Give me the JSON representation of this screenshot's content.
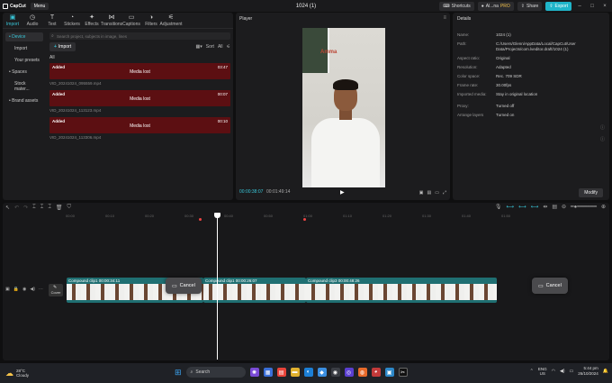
{
  "titlebar": {
    "app_name": "CapCut",
    "menu_label": "Menu",
    "document_title": "1024 (1)",
    "shortcuts_label": "Shortcuts",
    "user_label": "Al...na",
    "pro_badge": "PRO",
    "share_label": "Share",
    "export_label": "Export"
  },
  "tools": [
    {
      "label": "Import",
      "icon": "import-icon"
    },
    {
      "label": "Audio",
      "icon": "audio-icon"
    },
    {
      "label": "Text",
      "icon": "text-icon"
    },
    {
      "label": "Stickers",
      "icon": "stickers-icon"
    },
    {
      "label": "Effects",
      "icon": "effects-icon"
    },
    {
      "label": "Transitions",
      "icon": "transitions-icon"
    },
    {
      "label": "Captions",
      "icon": "captions-icon"
    },
    {
      "label": "Filters",
      "icon": "filters-icon"
    },
    {
      "label": "Adjustment",
      "icon": "adjustment-icon"
    }
  ],
  "media_sidebar": {
    "device": "• Device",
    "import": "Import",
    "your_presets": "Your presets",
    "spaces": "• Spaces",
    "stock": "Stock mater...",
    "brand": "• Brand assets"
  },
  "media": {
    "search_placeholder": "Search project, subjects in image, lines",
    "import_label": "Import",
    "sort_label": "Sort",
    "all_filter": "All",
    "all_label": "All",
    "clips": [
      {
        "added": "Added",
        "duration": "03:47",
        "status": "Media lost",
        "name": "VID_20241024_095559.mp4"
      },
      {
        "added": "Added",
        "duration": "00:07",
        "status": "Media lost",
        "name": "VID_20241024_113123.mp4"
      },
      {
        "added": "Added",
        "duration": "00:10",
        "status": "Media lost",
        "name": "VID_20241024_113306.mp4"
      }
    ]
  },
  "player": {
    "title": "Player",
    "video_sign": "Amma",
    "time_current": "00:00:38:07",
    "time_total": "00:01:49:14"
  },
  "details": {
    "title": "Details",
    "rows": [
      {
        "key": "Name:",
        "value": "1024 (1)"
      },
      {
        "key": "Path:",
        "value": "C:/Users/Glenn/AppData/Local/CapCut/User Data/Projects/com.lveditor.draft/1024 (1)"
      },
      {
        "key": "Aspect ratio:",
        "value": "Original"
      },
      {
        "key": "Resolution:",
        "value": "Adapted"
      },
      {
        "key": "Color space:",
        "value": "Rec. 709 SDR"
      },
      {
        "key": "Frame rate:",
        "value": "30.00fps"
      },
      {
        "key": "Imported media:",
        "value": "Stay in original location"
      },
      {
        "key": "Proxy:",
        "value": "Turned off"
      },
      {
        "key": "Arrange layers",
        "value": "Turned on"
      }
    ],
    "modify_label": "Modify"
  },
  "timeline": {
    "ruler_ticks": [
      "00:00",
      "00:10",
      "00:20",
      "00:30",
      "00:40",
      "00:50",
      "01:00",
      "01:10",
      "01:20",
      "01:30",
      "01:40",
      "01:50"
    ],
    "cover_label": "Cover",
    "clips": [
      {
        "label": "Compound clip1  00:00:34:11"
      },
      {
        "label": "Compound clip1  00:00:26:07"
      },
      {
        "label": "Compound clip3  00:00:48:26"
      }
    ],
    "cancel_label": "Cancel"
  },
  "taskbar": {
    "temperature": "28°C",
    "weather": "Cloudy",
    "search_label": "Search",
    "lang_top": "ENG",
    "lang_bottom": "US",
    "time": "5:44 pm",
    "date": "26/10/2024"
  },
  "colors": {
    "accent": "#39c6d8",
    "media_lost": "#5c0f12",
    "clip_track": "#1f6f72"
  }
}
